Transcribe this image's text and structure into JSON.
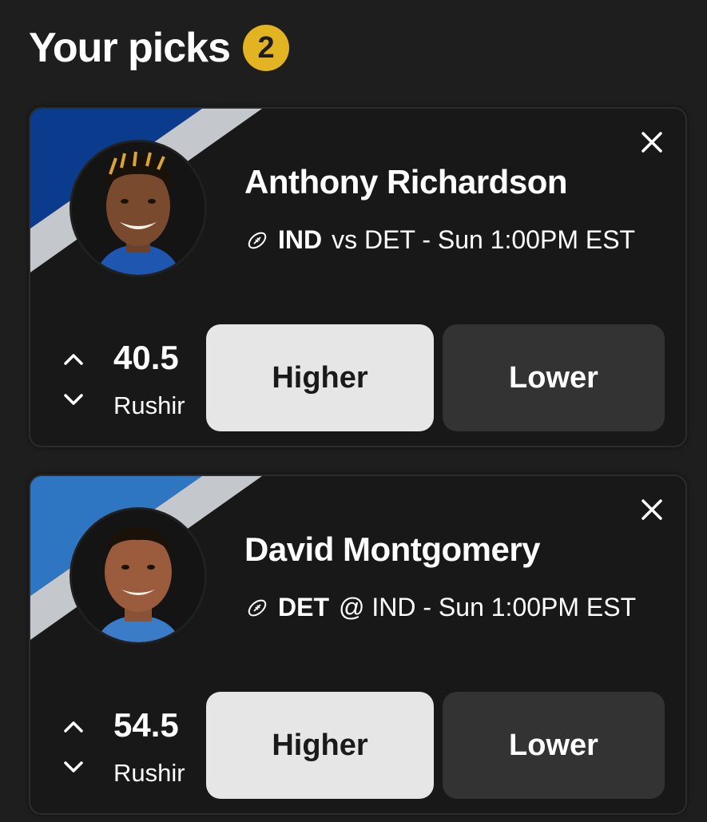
{
  "header": {
    "title": "Your picks",
    "count": "2"
  },
  "picks": [
    {
      "player": "Anthony Richardson",
      "team": "IND",
      "matchup_rest": "vs DET - Sun 1:00PM EST",
      "line": "40.5",
      "stat_type": "Rushir",
      "higher_label": "Higher",
      "lower_label": "Lower",
      "team_color": "#0b3b8c"
    },
    {
      "player": "David Montgomery",
      "team": "DET",
      "matchup_rest": "@ IND - Sun 1:00PM EST",
      "line": "54.5",
      "stat_type": "Rushir",
      "higher_label": "Higher",
      "lower_label": "Lower",
      "team_color": "#2f76c2"
    }
  ],
  "icons": {
    "close": "close-icon",
    "sport": "football-icon",
    "up": "chevron-up-icon",
    "down": "chevron-down-icon"
  },
  "colors": {
    "badge": "#e3b422",
    "background": "#1e1e1e",
    "card": "#181818",
    "stripe": "#c4c8cc"
  }
}
